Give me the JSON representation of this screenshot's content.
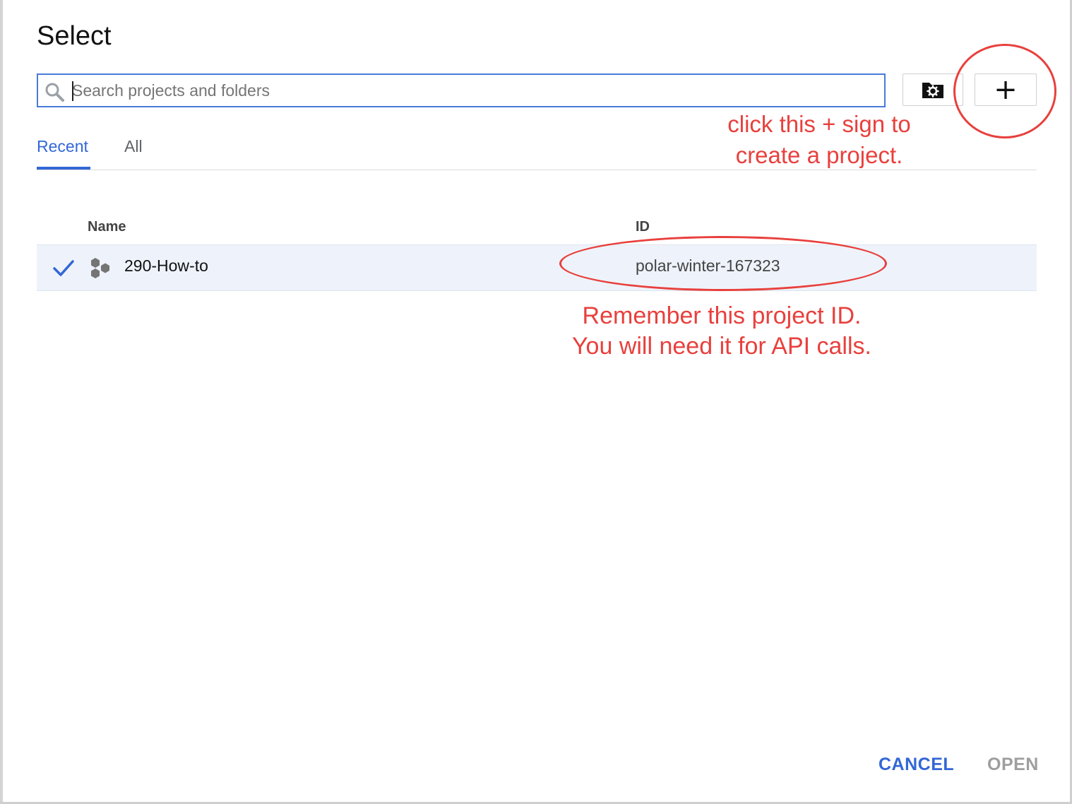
{
  "dialog": {
    "title": "Select"
  },
  "search": {
    "placeholder": "Search projects and folders",
    "value": ""
  },
  "toolbar": {
    "manage_folders_icon": "folder-gear-icon",
    "new_project_label": "+"
  },
  "tabs": [
    {
      "label": "Recent",
      "selected": true
    },
    {
      "label": "All",
      "selected": false
    }
  ],
  "table": {
    "columns": [
      "Name",
      "ID"
    ],
    "rows": [
      {
        "selected": true,
        "name": "290-How-to",
        "id": "polar-winter-167323"
      }
    ]
  },
  "annotations": {
    "new_project_note": "click this + sign to create a project.",
    "project_id_note_line1": "Remember this project ID.",
    "project_id_note_line2": "You will need it for API calls.",
    "color": "#e8403d"
  },
  "actions": {
    "cancel_label": "CANCEL",
    "open_label": "OPEN"
  },
  "colors": {
    "accent": "#3367d6",
    "selected_row": "#eef3fb",
    "disabled": "#9e9e9e"
  }
}
